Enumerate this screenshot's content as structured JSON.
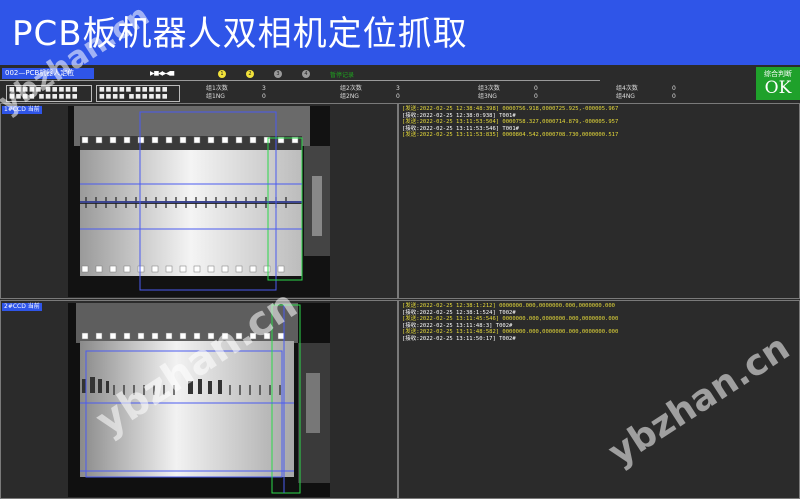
{
  "banner": {
    "title": "PCB板机器人双相机定位抓取"
  },
  "tabs": [
    {
      "label": "002—PCB机器人定位"
    }
  ],
  "toolbar": {
    "transport": "▶■◀▶◀■",
    "steps": [
      "1",
      "2",
      "3",
      "4"
    ],
    "record_text": "暂停记录"
  },
  "result": {
    "label": "综合判断",
    "value": "OK"
  },
  "io_panel": {
    "row1": "■■■■■ ■■■■■",
    "row2": "■■■■ ■■■■■■"
  },
  "stats": [
    {
      "label": "组1次数",
      "value": "3",
      "ng_label": "组1NG",
      "ng_value": "0"
    },
    {
      "label": "组2次数",
      "value": "3",
      "ng_label": "组2NG",
      "ng_value": "0"
    },
    {
      "label": "组3次数",
      "value": "0",
      "ng_label": "组3NG",
      "ng_value": "0"
    },
    {
      "label": "组4次数",
      "value": "0",
      "ng_label": "组4NG",
      "ng_value": "0"
    }
  ],
  "cameras": [
    {
      "label": "1#CCD 当前",
      "log": [
        {
          "text": "[发送:2022-02-25 12:38:48:398] 0000756.918,0000725.925,-000005.967",
          "color": "yellow"
        },
        {
          "text": "[接收:2022-02-25 12:38:0:938] T001#",
          "color": "white"
        },
        {
          "text": "[发送:2022-02-25 13:11:53:504] 0000758.327,0000714.879,-000005.957",
          "color": "yellow"
        },
        {
          "text": "[接收:2022-02-25 13:11:53:546] T001#",
          "color": "white"
        },
        {
          "text": "[发送:2022-02-25 13:11:53:835] 0000804.542,0000708.730,0000000.517",
          "color": "yellow"
        }
      ]
    },
    {
      "label": "2#CCD 当前",
      "log": [
        {
          "text": "[发送:2022-02-25 12:38:1:212] 0000000.000,0000000.000,0000000.000",
          "color": "yellow"
        },
        {
          "text": "[接收:2022-02-25 12:38:1:524] T002#",
          "color": "white"
        },
        {
          "text": "[发送:2022-02-25 13:11:45:546] 0000000.000,0000000.000,0000000.000",
          "color": "yellow"
        },
        {
          "text": "[接收:2022-02-25 13:11:48:3] T002#",
          "color": "white"
        },
        {
          "text": "[发送:2022-02-25 13:11:48:582] 0000000.000,0000000.000,0000000.000",
          "color": "yellow"
        },
        {
          "text": "[接收:2022-02-25 13:11:50:17] T002#",
          "color": "white"
        }
      ]
    }
  ],
  "watermarks": [
    "ybzhan.cn",
    "ybzhan.cn",
    "ybzhan.cn"
  ],
  "colors": {
    "accent": "#2f55e8",
    "ok": "#1fa12b",
    "log_send": "#e8dc3a",
    "log_recv": "#ffffff"
  }
}
